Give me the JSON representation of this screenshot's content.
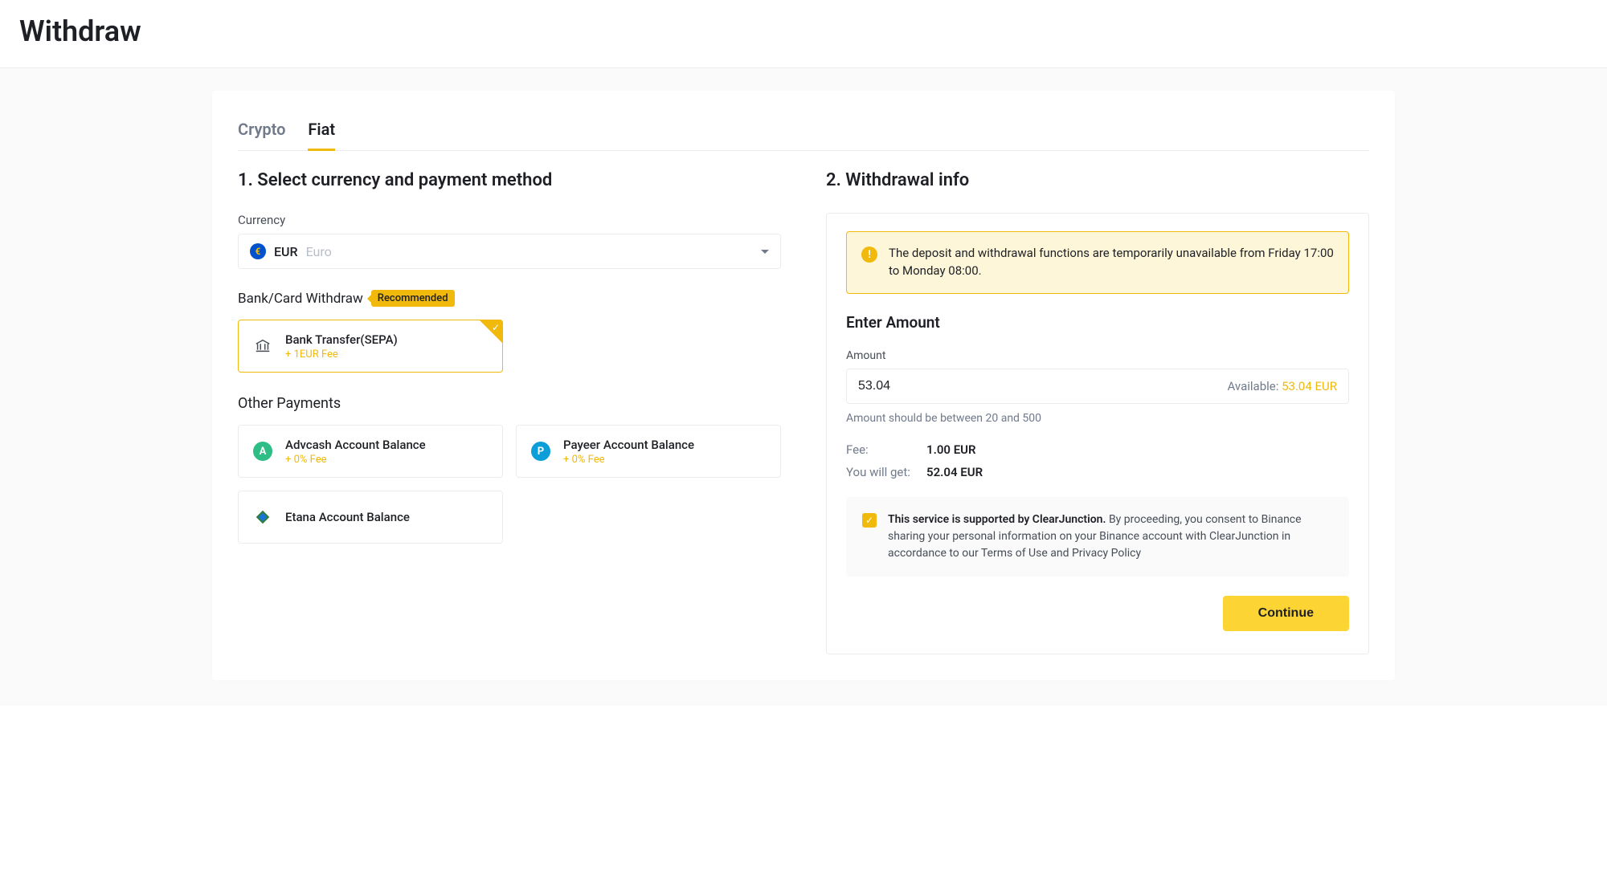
{
  "header": {
    "title": "Withdraw"
  },
  "tabs": {
    "crypto": "Crypto",
    "fiat": "Fiat",
    "active": "fiat"
  },
  "left": {
    "heading": "1. Select currency and payment method",
    "currency_label": "Currency",
    "currency": {
      "code": "EUR",
      "name": "Euro",
      "symbol": "€"
    },
    "bank_section_title": "Bank/Card Withdraw",
    "recommended_badge": "Recommended",
    "bank_methods": [
      {
        "title": "Bank Transfer(SEPA)",
        "sub": "+ 1EUR Fee",
        "selected": true
      }
    ],
    "other_title": "Other Payments",
    "other_methods": [
      {
        "title": "Advcash Account Balance",
        "sub": "+ 0% Fee",
        "icon": "A",
        "icon_class": "round-green"
      },
      {
        "title": "Payeer Account Balance",
        "sub": "+ 0% Fee",
        "icon": "P",
        "icon_class": "round-blue"
      },
      {
        "title": "Etana Account Balance",
        "sub": "",
        "icon": "◆",
        "icon_class": ""
      }
    ]
  },
  "right": {
    "heading": "2. Withdrawal info",
    "alert": "The deposit and withdrawal functions are temporarily unavailable from Friday 17:00 to Monday 08:00.",
    "enter_amount": "Enter Amount",
    "amount_label": "Amount",
    "amount_value": "53.04",
    "available_label": "Available: ",
    "available_value": "53.04 EUR",
    "hint": "Amount should be between 20 and 500",
    "fee_label": "Fee:",
    "fee_value": "1.00 EUR",
    "get_label": "You will get:",
    "get_value": "52.04 EUR",
    "consent_bold": "This service is supported by ClearJunction.",
    "consent_rest": " By proceeding, you consent to Binance sharing your personal information on your Binance account with ClearJunction in accordance to our Terms of Use and Privacy Policy",
    "continue": "Continue"
  }
}
